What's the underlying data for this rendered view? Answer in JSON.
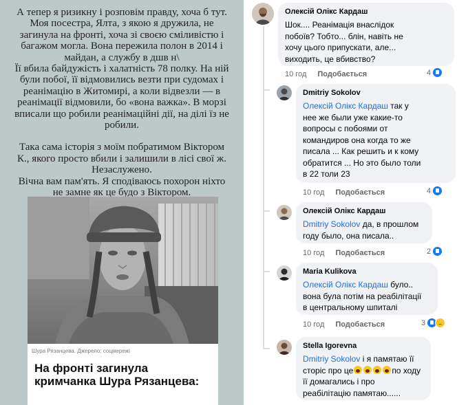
{
  "story": {
    "lines_p1": [
      "А тепер я ризикну і розповім правду, хоча б тут.",
      "Моя посестра, Ялта, з якою я дружила, не",
      "загинула на фронті, хоча зі своєю сміливістю і",
      "багажом могла. Вона пережила полон в 2014 і",
      "майдан, а службу в дшв н\\"
    ],
    "lines_p2": [
      "Її вбила байдужість і халатність 78 полку. На ній",
      "були побої, її відмовились везти при судомах і",
      "реанімацію в Житомирі, а коли відвезли — в",
      "реанімації відмовили, бо «вона важка». В морзі",
      "вписали що робили реанімаційні дії, на ділі їз не",
      "робили."
    ],
    "lines_p3": [
      "Така сама історія з моїм побратимом Віктором",
      "К., якого просто вбили і залишили в лісі свої ж.",
      "Незаслужено.",
      "Вічна вам пам'ять. Я сподіваюсь похорон ніхто",
      "не замне як це будо з Віктором."
    ],
    "caption": "Шура Рязанцева. Джерело: соцмережі",
    "headline_1": "На фронті загинула",
    "headline_2": "кримчанка Шура Рязанцева:"
  },
  "comments": [
    {
      "author": "Олексій Олікс Кардаш",
      "lines": [
        "Шок.... Реанімація внаслідок",
        "побоїв? Тобто... блін, навіть не",
        "хочу цього припускати, але...",
        "виходить, це вбивство?"
      ],
      "time": "10 год",
      "like": "Подобається",
      "count": "4"
    },
    {
      "author": "Dmitriy Sokolov",
      "mention": "Олексій Олікс Кардаш",
      "first_rest": " так у",
      "lines": [
        "нее же были уже какие-то",
        "вопросы с побоями от",
        "командиров она когда то же",
        "писала ... Как решить и к кому",
        "обратится ... Но это было толи",
        "в 22 толи 23"
      ],
      "time": "10 год",
      "like": "Подобається",
      "count": "4"
    },
    {
      "author": "Олексій Олікс Кардаш",
      "mention": "Dmitriy Sokolov",
      "first_rest": " да, в прошлом",
      "lines": [
        "году было, она писала.."
      ],
      "time": "10 год",
      "like": "Подобається",
      "count": "2"
    },
    {
      "author": "Maria Kulikova",
      "mention": "Олексій Олікс Кардаш",
      "first_rest": " було..",
      "lines": [
        "вона була потім на реабілітації",
        "в центральному шпиталі"
      ],
      "time": "10 год",
      "like": "Подобається",
      "count": "3"
    },
    {
      "author": "Stella Igorevna",
      "mention": "Dmitriy Sokolov",
      "first_rest": " і я памятаю її",
      "line2_a": "сторіс про це",
      "line2_b": "по ходу",
      "lines": [
        "її домагались і про",
        "реабілітацію памятаю......"
      ]
    }
  ],
  "colors": {
    "mention": "#216fdb",
    "like_blue": "#1877f2",
    "bubble": "#f0f2f5",
    "story_bg": "#bcc9c9"
  }
}
